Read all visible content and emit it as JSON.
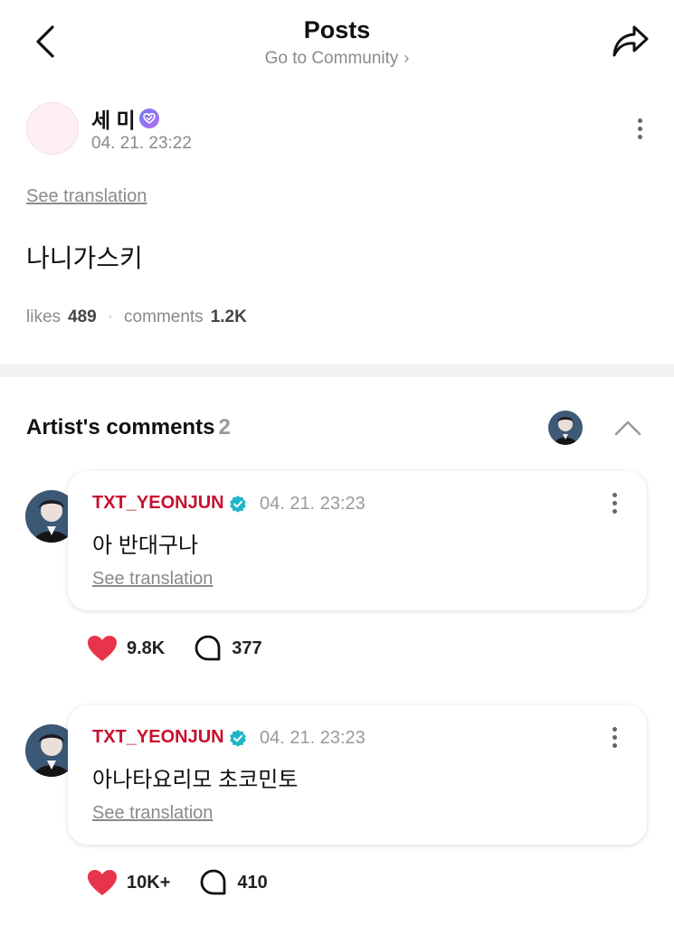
{
  "header": {
    "title": "Posts",
    "subtitle": "Go to Community",
    "subtitle_chevron": "›",
    "back_icon": "chevron-left-icon",
    "share_icon": "share-arrow-icon"
  },
  "post": {
    "author": "세 미",
    "verified_icon": "verified-heart-badge-icon",
    "time": "04. 21. 23:22",
    "see_translation": "See translation",
    "body": "나니가스키",
    "likes_label": "likes",
    "likes_value": "489",
    "comments_label": "comments",
    "comments_value": "1.2K",
    "separator": "·"
  },
  "artist_comments": {
    "title": "Artist's comments",
    "count": "2",
    "collapse_icon": "chevron-up-icon",
    "items": [
      {
        "name": "TXT_YEONJUN",
        "time": "04. 21. 23:23",
        "text": "아 반대구나",
        "see_translation": "See translation",
        "likes": "9.8K",
        "replies": "377"
      },
      {
        "name": "TXT_YEONJUN",
        "time": "04. 21. 23:23",
        "text": "아나타요리모 초코민토",
        "see_translation": "See translation",
        "likes": "10K+",
        "replies": "410"
      }
    ]
  },
  "colors": {
    "artist_name": "#c8102e",
    "heart": "#e8344a",
    "verified_teal": "#1fb5c6",
    "muted": "#8a8a8a"
  }
}
